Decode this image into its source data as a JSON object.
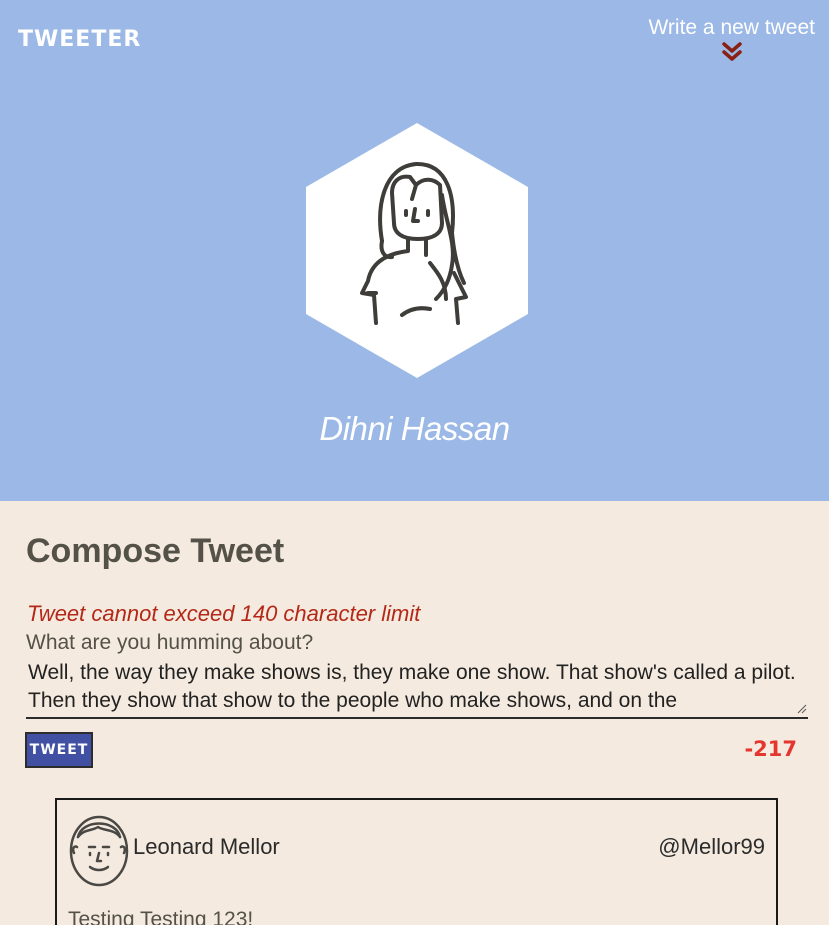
{
  "nav": {
    "logo": "TWEETER",
    "write_link": "Write a new tweet",
    "write_icon": "double-chevron-down-icon"
  },
  "profile": {
    "name": "Dihni Hassan",
    "avatar_icon": "woman-avatar-icon"
  },
  "compose": {
    "title": "Compose Tweet",
    "error": "Tweet cannot exceed 140 character limit",
    "label": "What are you humming about?",
    "text": "Well, the way they make shows is, they make one show. That show's called a pilot. Then they show that show to the people who make shows, and on the",
    "button": "TWEET",
    "counter": "-217"
  },
  "tweets": [
    {
      "name": "Leonard Mellor",
      "handle": "@Mellor99",
      "content": "Testing Testing 123!",
      "avatar_icon": "man-avatar-icon"
    }
  ],
  "colors": {
    "hero_bg": "#9bb8e6",
    "page_bg": "#f4eadf",
    "accent": "#4150a3",
    "error": "#b32817",
    "counter": "#e4352e",
    "chevron": "#8a1f14"
  }
}
